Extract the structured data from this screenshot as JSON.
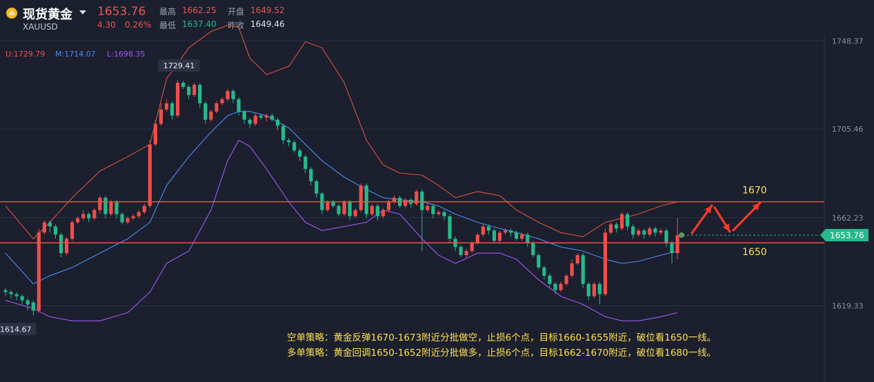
{
  "header": {
    "name": "现货黄金",
    "code": "XAUUSD",
    "price": "1653.76",
    "change": "4.30",
    "change_pct": "0.26%",
    "stats": [
      {
        "label": "最高",
        "value": "1662.25",
        "color": "#ef5350"
      },
      {
        "label": "开盘",
        "value": "1649.52",
        "color": "#ef5350"
      },
      {
        "label": "最低",
        "value": "1637.40",
        "color": "#26b98b"
      },
      {
        "label": "昨收",
        "value": "1649.46",
        "color": "#e4e6ec"
      }
    ]
  },
  "legend": {
    "upper": "U:1729.79",
    "middle": "M:1714.07",
    "lower": "L:1698.35"
  },
  "annotations": {
    "short_strategy": "空单策略：黄金反弹1670-1673附近分批做空，止损6个点，目标1660-1655附近，破位看1650一线。",
    "long_strategy": "多单策略：黄金回调1650-1652附近分批做多，止损6个点，目标1662-1670附近，破位看1680一线。"
  },
  "chart_data": {
    "type": "candlestick",
    "title": "",
    "indicator": "Bollinger Bands",
    "y_ticks": [
      1748.37,
      1705.46,
      1662.23,
      1619.33
    ],
    "current_price": 1653.76,
    "max_label": "1729.41",
    "min_label": "1614.67",
    "levels": [
      {
        "value": 1670,
        "label": "1670"
      },
      {
        "value": 1650,
        "label": "1650"
      }
    ],
    "candles": [
      [
        1627,
        1626,
        1624,
        1628
      ],
      [
        1626,
        1625,
        1623,
        1627
      ],
      [
        1625,
        1624,
        1622,
        1626
      ],
      [
        1624,
        1622,
        1620,
        1625
      ],
      [
        1622,
        1620,
        1617,
        1623
      ],
      [
        1621,
        1617,
        1614.67,
        1622
      ],
      [
        1617,
        1655,
        1616,
        1657
      ],
      [
        1655,
        1660,
        1654,
        1661
      ],
      [
        1660,
        1658,
        1655,
        1661
      ],
      [
        1658,
        1654,
        1652,
        1659
      ],
      [
        1654,
        1645,
        1643,
        1655
      ],
      [
        1645,
        1652,
        1644,
        1653
      ],
      [
        1652,
        1660,
        1651,
        1661
      ],
      [
        1660,
        1662,
        1659,
        1663
      ],
      [
        1662,
        1664,
        1661,
        1666
      ],
      [
        1664,
        1662,
        1660,
        1665
      ],
      [
        1662,
        1666,
        1661,
        1667
      ],
      [
        1666,
        1672,
        1664,
        1673
      ],
      [
        1672,
        1664,
        1662,
        1673
      ],
      [
        1664,
        1670,
        1663,
        1671
      ],
      [
        1670,
        1664,
        1662,
        1671
      ],
      [
        1664,
        1660,
        1659,
        1665
      ],
      [
        1660,
        1662,
        1659,
        1663
      ],
      [
        1662,
        1663,
        1661,
        1664
      ],
      [
        1663,
        1665,
        1662,
        1666
      ],
      [
        1665,
        1668,
        1664,
        1669
      ],
      [
        1668,
        1698,
        1667,
        1700
      ],
      [
        1698,
        1708,
        1697,
        1710
      ],
      [
        1708,
        1715,
        1707,
        1718
      ],
      [
        1715,
        1718,
        1714,
        1720
      ],
      [
        1718,
        1712,
        1710,
        1719
      ],
      [
        1712,
        1728,
        1711,
        1729.41
      ],
      [
        1728,
        1726,
        1725,
        1729
      ],
      [
        1726,
        1722,
        1720,
        1727
      ],
      [
        1722,
        1727,
        1721,
        1728
      ],
      [
        1727,
        1718,
        1716,
        1728
      ],
      [
        1718,
        1710,
        1708,
        1719
      ],
      [
        1710,
        1714,
        1709,
        1715
      ],
      [
        1714,
        1718,
        1713,
        1719
      ],
      [
        1718,
        1720,
        1717,
        1721
      ],
      [
        1720,
        1724,
        1719,
        1725
      ],
      [
        1724,
        1720,
        1718,
        1725
      ],
      [
        1720,
        1714,
        1712,
        1721
      ],
      [
        1714,
        1710,
        1708,
        1715
      ],
      [
        1710,
        1708,
        1706,
        1711
      ],
      [
        1708,
        1712,
        1707,
        1713
      ],
      [
        1712,
        1711,
        1710,
        1713
      ],
      [
        1711,
        1712,
        1709,
        1713
      ],
      [
        1712,
        1710,
        1709,
        1713
      ],
      [
        1710,
        1707,
        1705,
        1711
      ],
      [
        1707,
        1700,
        1698,
        1708
      ],
      [
        1700,
        1699,
        1697,
        1701
      ],
      [
        1699,
        1695,
        1694,
        1700
      ],
      [
        1695,
        1692,
        1690,
        1696
      ],
      [
        1692,
        1686,
        1684,
        1693
      ],
      [
        1686,
        1680,
        1678,
        1687
      ],
      [
        1680,
        1674,
        1672,
        1681
      ],
      [
        1674,
        1666,
        1664,
        1675
      ],
      [
        1666,
        1670,
        1665,
        1671
      ],
      [
        1670,
        1668,
        1667,
        1671
      ],
      [
        1668,
        1664,
        1663,
        1669
      ],
      [
        1664,
        1670,
        1663,
        1671
      ],
      [
        1670,
        1663,
        1661,
        1671
      ],
      [
        1663,
        1666,
        1662,
        1667
      ],
      [
        1666,
        1678,
        1665,
        1679
      ],
      [
        1678,
        1664,
        1662,
        1679
      ],
      [
        1664,
        1668,
        1663,
        1669
      ],
      [
        1668,
        1663,
        1661,
        1669
      ],
      [
        1663,
        1666,
        1662,
        1667
      ],
      [
        1666,
        1670,
        1665,
        1671
      ],
      [
        1670,
        1672,
        1669,
        1673
      ],
      [
        1672,
        1668,
        1667,
        1673
      ],
      [
        1668,
        1671,
        1667,
        1672
      ],
      [
        1671,
        1669,
        1667,
        1672
      ],
      [
        1669,
        1675,
        1668,
        1676
      ],
      [
        1675,
        1666,
        1646,
        1676
      ],
      [
        1666,
        1668,
        1665,
        1669
      ],
      [
        1668,
        1664,
        1662,
        1669
      ],
      [
        1664,
        1665,
        1663,
        1666
      ],
      [
        1665,
        1663,
        1661,
        1666
      ],
      [
        1663,
        1652,
        1650,
        1664
      ],
      [
        1652,
        1648,
        1646,
        1653
      ],
      [
        1648,
        1644,
        1643,
        1649
      ],
      [
        1644,
        1646,
        1643,
        1647
      ],
      [
        1646,
        1650,
        1645,
        1651
      ],
      [
        1650,
        1654,
        1649,
        1655
      ],
      [
        1654,
        1658,
        1653,
        1659
      ],
      [
        1658,
        1656,
        1654,
        1659
      ],
      [
        1656,
        1651,
        1650,
        1657
      ],
      [
        1651,
        1655,
        1650,
        1656
      ],
      [
        1655,
        1656,
        1654,
        1657
      ],
      [
        1656,
        1655,
        1653,
        1657
      ],
      [
        1655,
        1652,
        1651,
        1656
      ],
      [
        1652,
        1654,
        1651,
        1655
      ],
      [
        1654,
        1650,
        1648,
        1655
      ],
      [
        1650,
        1644,
        1643,
        1651
      ],
      [
        1644,
        1638,
        1637,
        1645
      ],
      [
        1638,
        1634,
        1632,
        1639
      ],
      [
        1634,
        1630,
        1628,
        1635
      ],
      [
        1630,
        1627,
        1625,
        1631
      ],
      [
        1627,
        1630,
        1626,
        1631
      ],
      [
        1630,
        1634,
        1629,
        1635
      ],
      [
        1634,
        1640,
        1633,
        1642
      ],
      [
        1640,
        1644,
        1639,
        1645
      ],
      [
        1644,
        1630,
        1628,
        1645
      ],
      [
        1630,
        1624,
        1622,
        1631
      ],
      [
        1624,
        1630,
        1623,
        1631
      ],
      [
        1630,
        1625,
        1620,
        1631
      ],
      [
        1625,
        1655,
        1624,
        1657
      ],
      [
        1655,
        1659,
        1654,
        1660
      ],
      [
        1659,
        1657,
        1655,
        1660
      ],
      [
        1657,
        1664,
        1656,
        1665
      ],
      [
        1664,
        1658,
        1656,
        1665
      ],
      [
        1658,
        1654,
        1652,
        1659
      ],
      [
        1654,
        1656,
        1653,
        1657
      ],
      [
        1656,
        1654,
        1652,
        1657
      ],
      [
        1654,
        1657,
        1653,
        1658
      ],
      [
        1657,
        1655,
        1653,
        1658
      ],
      [
        1655,
        1656,
        1654,
        1657
      ],
      [
        1656,
        1650,
        1648,
        1657
      ],
      [
        1650,
        1645,
        1640,
        1651
      ],
      [
        1645,
        1653.76,
        1642,
        1662.25
      ]
    ],
    "upper_band": [
      [
        0,
        1668
      ],
      [
        5,
        1652
      ],
      [
        8,
        1660
      ],
      [
        12,
        1672
      ],
      [
        17,
        1685
      ],
      [
        22,
        1692
      ],
      [
        26,
        1698
      ],
      [
        29,
        1730
      ],
      [
        33,
        1745
      ],
      [
        37,
        1753
      ],
      [
        40,
        1756
      ],
      [
        42,
        1755
      ],
      [
        44,
        1740
      ],
      [
        47,
        1732
      ],
      [
        51,
        1736
      ],
      [
        54,
        1748
      ],
      [
        57,
        1745
      ],
      [
        61,
        1728
      ],
      [
        65,
        1700
      ],
      [
        68,
        1688
      ],
      [
        71,
        1684
      ],
      [
        75,
        1683
      ],
      [
        78,
        1678
      ],
      [
        81,
        1672
      ],
      [
        85,
        1675
      ],
      [
        89,
        1673
      ],
      [
        92,
        1666
      ],
      [
        96,
        1660
      ],
      [
        100,
        1655
      ],
      [
        104,
        1653
      ],
      [
        108,
        1660
      ],
      [
        111,
        1662
      ],
      [
        114,
        1664
      ],
      [
        118,
        1668
      ],
      [
        121,
        1670
      ]
    ],
    "middle_band": [
      [
        0,
        1645
      ],
      [
        5,
        1630
      ],
      [
        8,
        1634
      ],
      [
        12,
        1638
      ],
      [
        17,
        1645
      ],
      [
        22,
        1652
      ],
      [
        26,
        1660
      ],
      [
        29,
        1678
      ],
      [
        33,
        1692
      ],
      [
        37,
        1704
      ],
      [
        40,
        1712
      ],
      [
        42,
        1714
      ],
      [
        44,
        1714
      ],
      [
        47,
        1712
      ],
      [
        51,
        1706
      ],
      [
        54,
        1698
      ],
      [
        57,
        1690
      ],
      [
        61,
        1682
      ],
      [
        65,
        1676
      ],
      [
        68,
        1672
      ],
      [
        71,
        1671
      ],
      [
        75,
        1670
      ],
      [
        78,
        1668
      ],
      [
        81,
        1664
      ],
      [
        85,
        1660
      ],
      [
        89,
        1657
      ],
      [
        92,
        1655
      ],
      [
        96,
        1652
      ],
      [
        100,
        1648
      ],
      [
        104,
        1646
      ],
      [
        108,
        1642
      ],
      [
        111,
        1640
      ],
      [
        114,
        1641
      ],
      [
        118,
        1644
      ],
      [
        121,
        1646
      ]
    ],
    "lower_band": [
      [
        0,
        1622
      ],
      [
        5,
        1618
      ],
      [
        8,
        1614
      ],
      [
        12,
        1612
      ],
      [
        17,
        1612
      ],
      [
        22,
        1616
      ],
      [
        26,
        1626
      ],
      [
        29,
        1640
      ],
      [
        33,
        1646
      ],
      [
        37,
        1666
      ],
      [
        40,
        1690
      ],
      [
        42,
        1700
      ],
      [
        44,
        1697
      ],
      [
        47,
        1686
      ],
      [
        51,
        1670
      ],
      [
        54,
        1660
      ],
      [
        57,
        1656
      ],
      [
        61,
        1658
      ],
      [
        65,
        1660
      ],
      [
        68,
        1666
      ],
      [
        71,
        1664
      ],
      [
        75,
        1652
      ],
      [
        78,
        1644
      ],
      [
        81,
        1640
      ],
      [
        85,
        1645
      ],
      [
        89,
        1645
      ],
      [
        92,
        1642
      ],
      [
        96,
        1632
      ],
      [
        100,
        1624
      ],
      [
        104,
        1620
      ],
      [
        108,
        1614
      ],
      [
        111,
        1612
      ],
      [
        114,
        1612
      ],
      [
        118,
        1614
      ],
      [
        121,
        1616
      ]
    ]
  }
}
